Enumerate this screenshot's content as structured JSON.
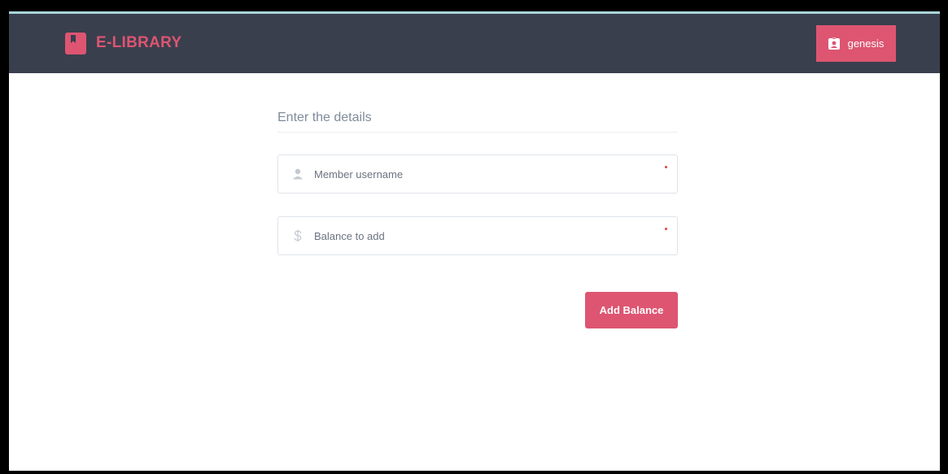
{
  "brand": {
    "name": "E-LIBRARY",
    "color": "#dd5571"
  },
  "user": {
    "name": "genesis",
    "icon": "id-badge-icon"
  },
  "form": {
    "heading": "Enter the details",
    "username": {
      "icon": "user-icon",
      "placeholder": "Member username",
      "value": ""
    },
    "balance": {
      "icon": "dollar-icon",
      "placeholder": "Balance to add",
      "value": ""
    },
    "submit_label": "Add Balance"
  },
  "colors": {
    "navbar": "#3a3f4e",
    "accent": "#dd5571",
    "required": "#e53e3e"
  }
}
